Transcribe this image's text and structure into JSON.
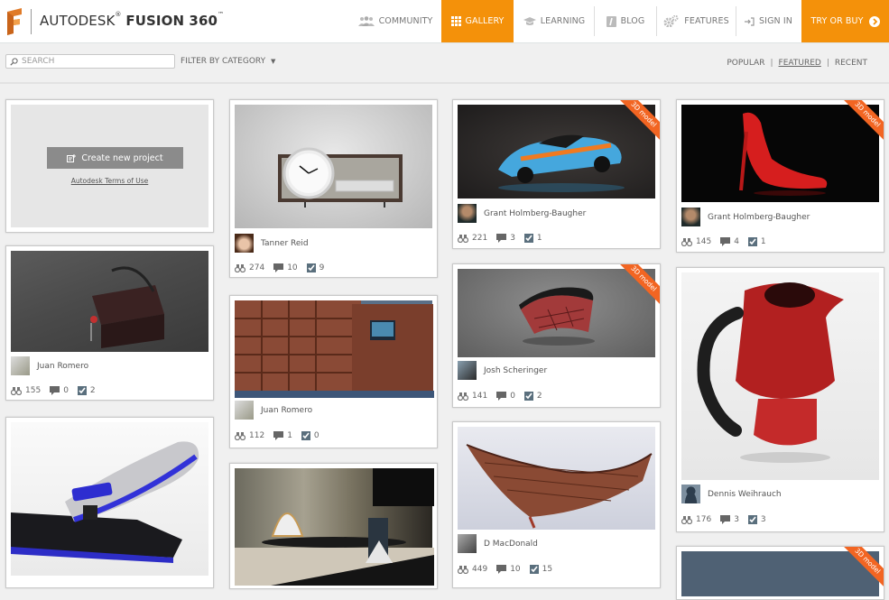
{
  "header": {
    "brand_light": "AUTODESK",
    "brand_bold": "FUSION 360",
    "brand_mark": "™",
    "nav": [
      {
        "label": "COMMUNITY",
        "icon": "community-icon"
      },
      {
        "label": "GALLERY",
        "icon": "grid-icon",
        "active": true
      },
      {
        "label": "LEARNING",
        "icon": "graduation-cap-icon"
      },
      {
        "label": "BLOG",
        "icon": "blog-icon"
      },
      {
        "label": "FEATURES",
        "icon": "gears-icon"
      },
      {
        "label": "SIGN IN",
        "icon": "sign-in-icon"
      },
      {
        "label": "TRY OR BUY",
        "icon": "chevron-right-circle-icon"
      }
    ],
    "accent_color": "#f4910a"
  },
  "filters": {
    "search_placeholder": "SEARCH",
    "filter_label": "FILTER BY CATEGORY",
    "sorts": [
      "POPULAR",
      "FEATURED",
      "RECENT"
    ],
    "active_sort": "FEATURED"
  },
  "create": {
    "button_label": "Create new project",
    "terms_label": "Autodesk Terms of Use"
  },
  "ribbon_label": "3D model",
  "cards": [
    {
      "author": "Juan Romero",
      "views": "155",
      "comments": "0",
      "likes": "2"
    },
    {
      "author": "",
      "views": "",
      "comments": "",
      "likes": ""
    },
    {
      "author": "Tanner Reid",
      "views": "274",
      "comments": "10",
      "likes": "9"
    },
    {
      "author": "Juan Romero",
      "views": "112",
      "comments": "1",
      "likes": "0"
    },
    {
      "author": "",
      "views": "",
      "comments": "",
      "likes": ""
    },
    {
      "author": "Grant Holmberg-Baugher",
      "views": "221",
      "comments": "3",
      "likes": "1",
      "badge": "3D model"
    },
    {
      "author": "Josh Scheringer",
      "views": "141",
      "comments": "0",
      "likes": "2",
      "badge": "3D model"
    },
    {
      "author": "D MacDonald",
      "views": "449",
      "comments": "10",
      "likes": "15"
    },
    {
      "author": "Grant Holmberg-Baugher",
      "views": "145",
      "comments": "4",
      "likes": "1",
      "badge": "3D model"
    },
    {
      "author": "Dennis Weihrauch",
      "views": "176",
      "comments": "3",
      "likes": "3"
    },
    {
      "author": "",
      "views": "",
      "comments": "",
      "likes": "",
      "badge": "3D model"
    }
  ]
}
